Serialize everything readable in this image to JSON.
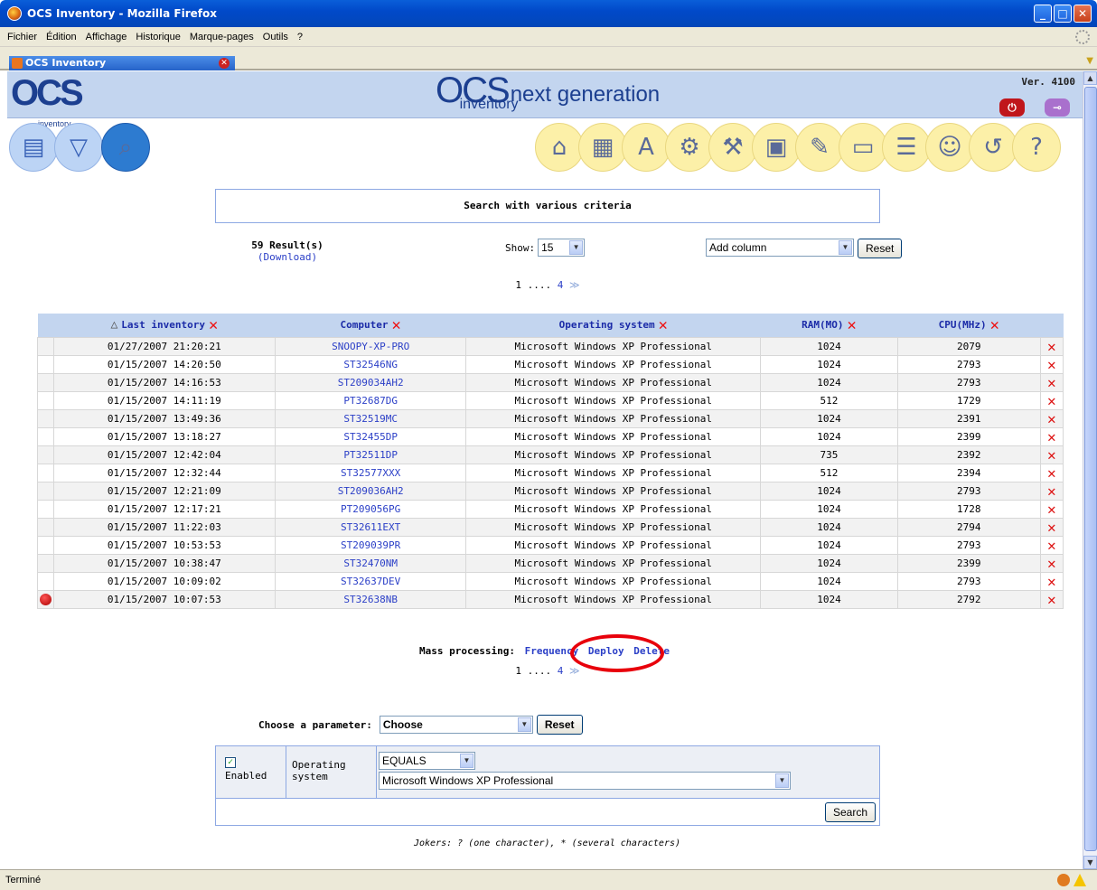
{
  "window": {
    "title": "OCS Inventory - Mozilla Firefox"
  },
  "menu": [
    "Fichier",
    "Édition",
    "Affichage",
    "Historique",
    "Marque-pages",
    "Outils",
    "?"
  ],
  "tab": {
    "label": "OCS Inventory"
  },
  "status": "Terminé",
  "header": {
    "logo": "OCS",
    "logo_sub": "inventory",
    "center_logo": "OCS",
    "center_sub": "inventory",
    "tagline": "next generation",
    "version": "Ver. 4100"
  },
  "search_box": {
    "title": "Search with various criteria"
  },
  "results": {
    "count": "59 Result(s)",
    "download": "(Download)"
  },
  "show": {
    "label": "Show:",
    "value": "15"
  },
  "add_column": {
    "value": "Add column",
    "reset": "Reset"
  },
  "pager": {
    "first": "1",
    "sep": " .... ",
    "last": "4",
    "next": "≫"
  },
  "table": {
    "headers": [
      "Last inventory",
      "Computer",
      "Operating system",
      "RAM(MO)",
      "CPU(MHz)"
    ],
    "rows": [
      [
        "01/27/2007 21:20:21",
        "SNOOPY-XP-PRO",
        "Microsoft Windows XP Professional",
        "1024",
        "2079"
      ],
      [
        "01/15/2007 14:20:50",
        "ST32546NG",
        "Microsoft Windows XP Professional",
        "1024",
        "2793"
      ],
      [
        "01/15/2007 14:16:53",
        "ST209034AH2",
        "Microsoft Windows XP Professional",
        "1024",
        "2793"
      ],
      [
        "01/15/2007 14:11:19",
        "PT32687DG",
        "Microsoft Windows XP Professional",
        "512",
        "1729"
      ],
      [
        "01/15/2007 13:49:36",
        "ST32519MC",
        "Microsoft Windows XP Professional",
        "1024",
        "2391"
      ],
      [
        "01/15/2007 13:18:27",
        "ST32455DP",
        "Microsoft Windows XP Professional",
        "1024",
        "2399"
      ],
      [
        "01/15/2007 12:42:04",
        "PT32511DP",
        "Microsoft Windows XP Professional",
        "735",
        "2392"
      ],
      [
        "01/15/2007 12:32:44",
        "ST32577XXX",
        "Microsoft Windows XP Professional",
        "512",
        "2394"
      ],
      [
        "01/15/2007 12:21:09",
        "ST209036AH2",
        "Microsoft Windows XP Professional",
        "1024",
        "2793"
      ],
      [
        "01/15/2007 12:17:21",
        "PT209056PG",
        "Microsoft Windows XP Professional",
        "1024",
        "1728"
      ],
      [
        "01/15/2007 11:22:03",
        "ST32611EXT",
        "Microsoft Windows XP Professional",
        "1024",
        "2794"
      ],
      [
        "01/15/2007 10:53:53",
        "ST209039PR",
        "Microsoft Windows XP Professional",
        "1024",
        "2793"
      ],
      [
        "01/15/2007 10:38:47",
        "ST32470NM",
        "Microsoft Windows XP Professional",
        "1024",
        "2399"
      ],
      [
        "01/15/2007 10:09:02",
        "ST32637DEV",
        "Microsoft Windows XP Professional",
        "1024",
        "2793"
      ],
      [
        "01/15/2007 10:07:53",
        "ST32638NB",
        "Microsoft Windows XP Professional",
        "1024",
        "2792"
      ]
    ]
  },
  "mass": {
    "label": "Mass processing:",
    "frequency": "Frequency",
    "deploy": "Deploy",
    "delete": "Delete"
  },
  "param": {
    "label": "Choose a parameter:",
    "value": "Choose",
    "reset": "Reset"
  },
  "criteria": {
    "enabled": "Enabled",
    "field": "Operating system",
    "operator": "EQUALS",
    "value": "Microsoft Windows XP Professional",
    "search": "Search"
  },
  "jokers": "Jokers: ? (one character), * (several characters)",
  "colors": {
    "header_bg": "#c3d5ef",
    "link": "#2b3fc7",
    "accent_red": "#e11111",
    "icon_yellow": "#fcf0a8"
  }
}
